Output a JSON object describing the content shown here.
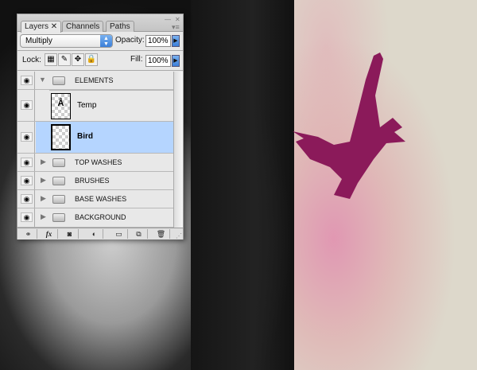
{
  "panel": {
    "tabs": [
      {
        "label": "Layers",
        "active": true
      },
      {
        "label": "Channels"
      },
      {
        "label": "Paths"
      }
    ],
    "blend_mode": "Multiply",
    "opacity_label": "Opacity:",
    "opacity": "100%",
    "lock_label": "Lock:",
    "fill_label": "Fill:",
    "fill": "100%"
  },
  "layers": [
    {
      "name": "ELEMENTS",
      "type": "group",
      "expanded": true,
      "visible": true
    },
    {
      "name": "Temp",
      "type": "layer",
      "visible": true
    },
    {
      "name": "Bird",
      "type": "layer",
      "visible": true,
      "selected": true
    },
    {
      "name": "TOP WASHES",
      "type": "group",
      "expanded": false,
      "visible": true
    },
    {
      "name": "BRUSHES",
      "type": "group",
      "expanded": false,
      "visible": true
    },
    {
      "name": "BASE WASHES",
      "type": "group",
      "expanded": false,
      "visible": true
    },
    {
      "name": "BACKGROUND",
      "type": "group",
      "expanded": false,
      "visible": true
    }
  ],
  "colors": {
    "selection": "#b5d5ff",
    "bird": "#8b1a5a",
    "accent": "#3c7fd8"
  }
}
